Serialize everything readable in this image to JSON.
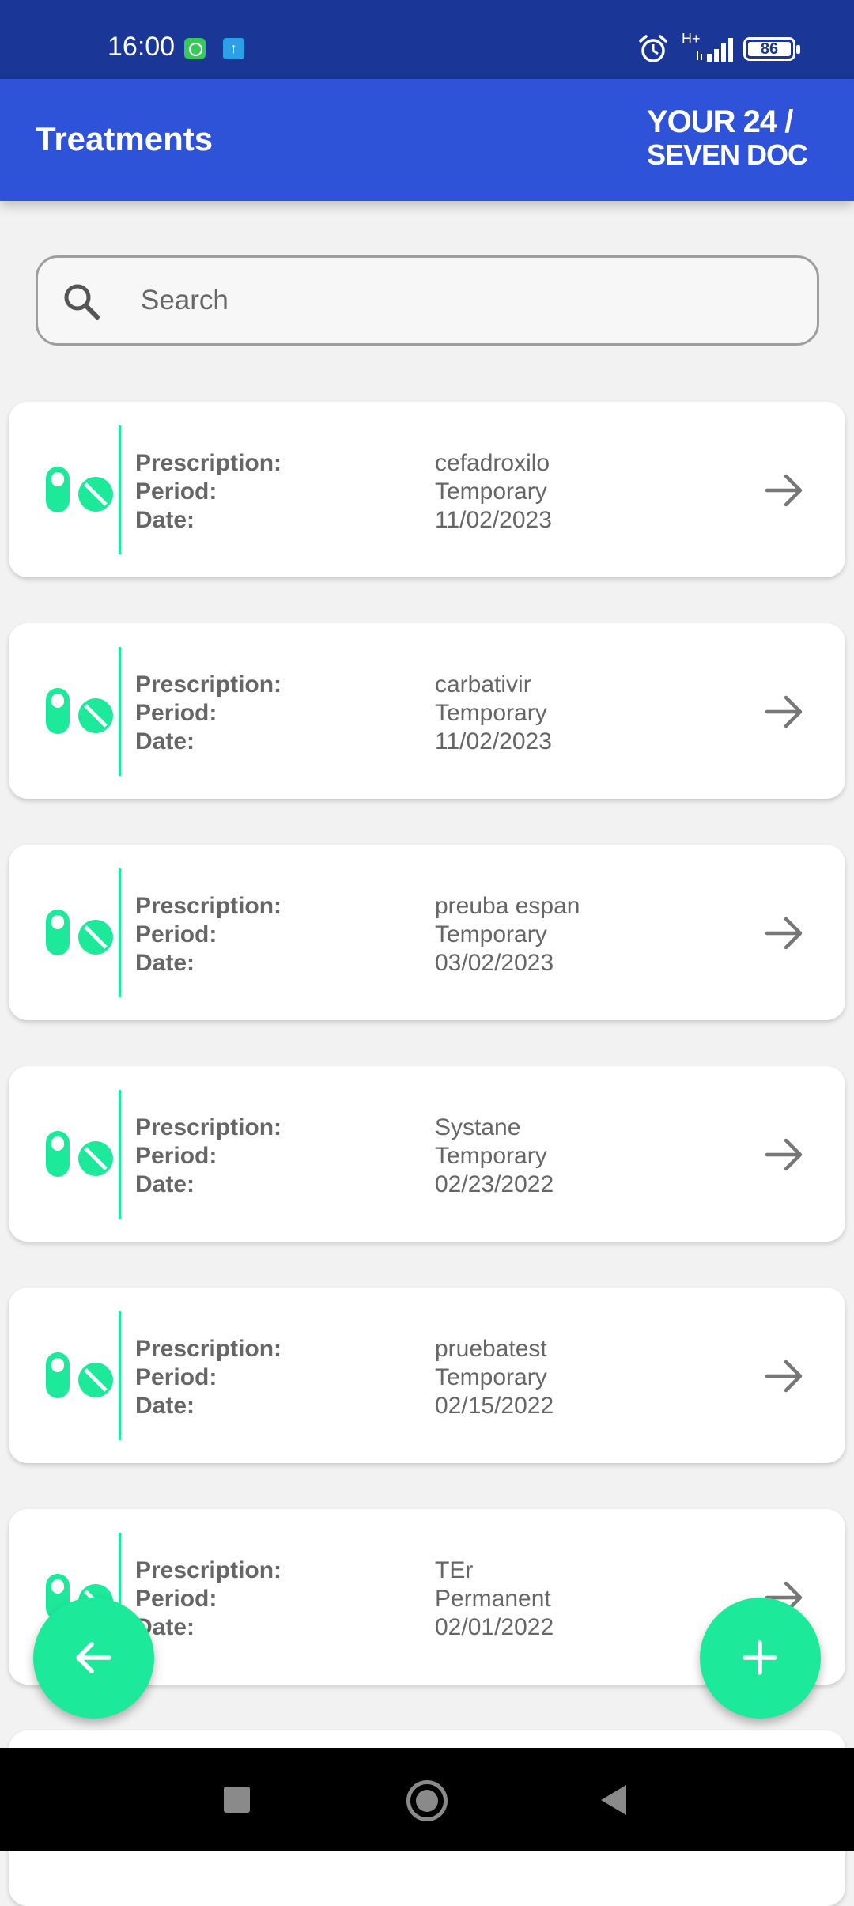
{
  "status_bar": {
    "time": "16:00",
    "network": "H+",
    "battery": "86"
  },
  "app_bar": {
    "title": "Treatments",
    "logo_line1": "YOUR 24 /",
    "logo_line2": "SEVEN DOC"
  },
  "search": {
    "placeholder": "Search",
    "value": ""
  },
  "labels": {
    "prescription": "Prescription:",
    "period": "Period:",
    "date": "Date:"
  },
  "treatments": [
    {
      "prescription": "cefadroxilo",
      "period": "Temporary",
      "date": "11/02/2023"
    },
    {
      "prescription": "carbativir",
      "period": "Temporary",
      "date": "11/02/2023"
    },
    {
      "prescription": "preuba espan",
      "period": "Temporary",
      "date": "03/02/2023"
    },
    {
      "prescription": "Systane",
      "period": "Temporary",
      "date": "02/23/2022"
    },
    {
      "prescription": "pruebatest",
      "period": "Temporary",
      "date": "02/15/2022"
    },
    {
      "prescription": "TEr",
      "period": "Permanent",
      "date": "02/01/2022"
    }
  ],
  "colors": {
    "status_bar": "#1a3797",
    "app_bar": "#2e52d8",
    "accent": "#1de99b",
    "background": "#f2f2f2"
  },
  "icons": {
    "card_icon": "pills-icon",
    "card_action": "arrow-right-icon",
    "fab_left": "arrow-left-icon",
    "fab_right": "plus-icon",
    "search": "search-icon"
  }
}
